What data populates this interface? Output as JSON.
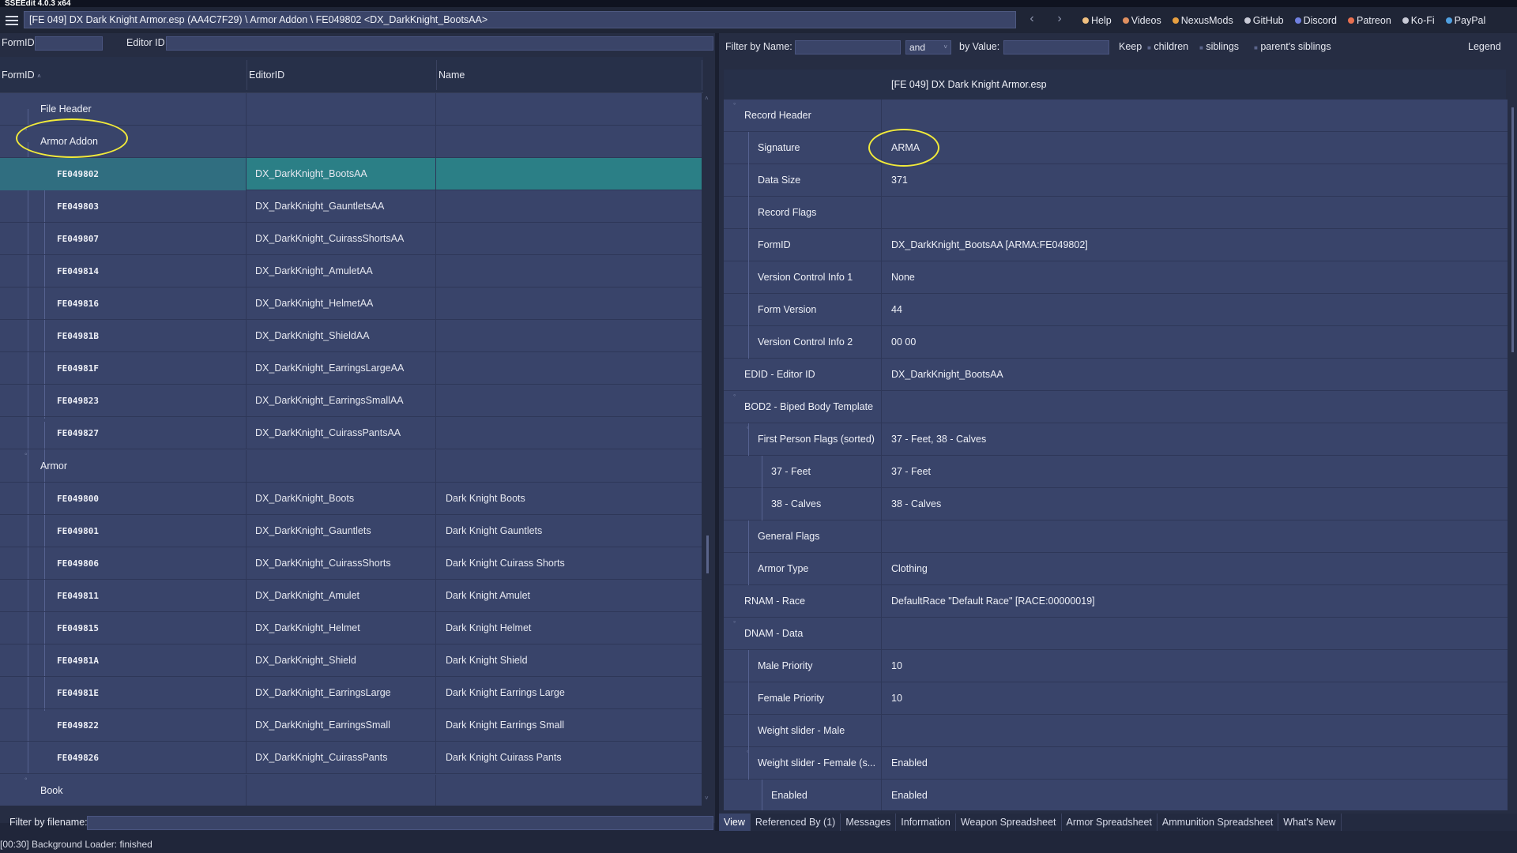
{
  "app": {
    "title": "SSEEdit 4.0.3 x64"
  },
  "topbar": {
    "path": "[FE 049] DX Dark Knight Armor.esp (AA4C7F29) \\ Armor Addon \\ FE049802 <DX_DarkKnight_BootsAA>",
    "links": [
      {
        "label": "Help",
        "color": "#f0c080"
      },
      {
        "label": "Videos",
        "color": "#e09060"
      },
      {
        "label": "NexusMods",
        "color": "#e8a040"
      },
      {
        "label": "GitHub",
        "color": "#c8cad6"
      },
      {
        "label": "Discord",
        "color": "#7080e0"
      },
      {
        "label": "Patreon",
        "color": "#e87050"
      },
      {
        "label": "Ko-Fi",
        "color": "#c8cad6"
      },
      {
        "label": "PayPal",
        "color": "#50a0e0"
      }
    ]
  },
  "left": {
    "formid_label": "FormID",
    "editorid_label": "Editor ID",
    "columns": {
      "formid": "FormID",
      "editorid": "EditorID",
      "name": "Name"
    },
    "groups": {
      "file_header": "File Header",
      "armor_addon": "Armor Addon",
      "armor": "Armor",
      "book": "Book"
    },
    "armor_addon_rows": [
      {
        "formid": "FE049802",
        "editorid": "DX_DarkKnight_BootsAA",
        "name": ""
      },
      {
        "formid": "FE049803",
        "editorid": "DX_DarkKnight_GauntletsAA",
        "name": ""
      },
      {
        "formid": "FE049807",
        "editorid": "DX_DarkKnight_CuirassShortsAA",
        "name": ""
      },
      {
        "formid": "FE049814",
        "editorid": "DX_DarkKnight_AmuletAA",
        "name": ""
      },
      {
        "formid": "FE049816",
        "editorid": "DX_DarkKnight_HelmetAA",
        "name": ""
      },
      {
        "formid": "FE04981B",
        "editorid": "DX_DarkKnight_ShieldAA",
        "name": ""
      },
      {
        "formid": "FE04981F",
        "editorid": "DX_DarkKnight_EarringsLargeAA",
        "name": ""
      },
      {
        "formid": "FE049823",
        "editorid": "DX_DarkKnight_EarringsSmallAA",
        "name": ""
      },
      {
        "formid": "FE049827",
        "editorid": "DX_DarkKnight_CuirassPantsAA",
        "name": ""
      }
    ],
    "armor_rows": [
      {
        "formid": "FE049800",
        "editorid": "DX_DarkKnight_Boots",
        "name": "Dark Knight Boots"
      },
      {
        "formid": "FE049801",
        "editorid": "DX_DarkKnight_Gauntlets",
        "name": "Dark Knight Gauntlets"
      },
      {
        "formid": "FE049806",
        "editorid": "DX_DarkKnight_CuirassShorts",
        "name": "Dark Knight Cuirass Shorts"
      },
      {
        "formid": "FE049811",
        "editorid": "DX_DarkKnight_Amulet",
        "name": "Dark Knight Amulet"
      },
      {
        "formid": "FE049815",
        "editorid": "DX_DarkKnight_Helmet",
        "name": "Dark Knight Helmet"
      },
      {
        "formid": "FE04981A",
        "editorid": "DX_DarkKnight_Shield",
        "name": "Dark Knight Shield"
      },
      {
        "formid": "FE04981E",
        "editorid": "DX_DarkKnight_EarringsLarge",
        "name": "Dark Knight Earrings Large"
      },
      {
        "formid": "FE049822",
        "editorid": "DX_DarkKnight_EarringsSmall",
        "name": "Dark Knight Earrings Small"
      },
      {
        "formid": "FE049826",
        "editorid": "DX_DarkKnight_CuirassPants",
        "name": "Dark Knight Cuirass Pants"
      }
    ],
    "filter_by_filename_label": "Filter by filename:",
    "status": "[00:30] Background Loader: finished"
  },
  "right": {
    "filter_by_name_label": "Filter by Name:",
    "and_label": "and",
    "by_value_label": "by Value:",
    "keep_label": "Keep",
    "children_label": "children",
    "siblings_label": "siblings",
    "parents_siblings_label": "parent's siblings",
    "legend_label": "Legend",
    "header_file": "[FE 049] DX Dark Knight Armor.esp",
    "record_rows": [
      {
        "key": "Record Header",
        "value": "",
        "level": 0,
        "expander": true
      },
      {
        "key": "Signature",
        "value": "ARMA",
        "level": 1,
        "expander": false
      },
      {
        "key": "Data Size",
        "value": "371",
        "level": 1,
        "expander": false
      },
      {
        "key": "Record Flags",
        "value": "",
        "level": 1,
        "expander": false
      },
      {
        "key": "FormID",
        "value": "DX_DarkKnight_BootsAA [ARMA:FE049802]",
        "level": 1,
        "expander": false
      },
      {
        "key": "Version Control Info 1",
        "value": "None",
        "level": 1,
        "expander": false
      },
      {
        "key": "Form Version",
        "value": "44",
        "level": 1,
        "expander": false
      },
      {
        "key": "Version Control Info 2",
        "value": "00 00",
        "level": 1,
        "expander": false
      },
      {
        "key": "EDID - Editor ID",
        "value": "DX_DarkKnight_BootsAA",
        "level": 0,
        "expander": false
      },
      {
        "key": "BOD2 - Biped Body Template",
        "value": "",
        "level": 0,
        "expander": true
      },
      {
        "key": "First Person Flags (sorted)",
        "value": "37 - Feet, 38 - Calves",
        "level": 1,
        "expander": true
      },
      {
        "key": "37 - Feet",
        "value": "37 - Feet",
        "level": 2,
        "expander": false
      },
      {
        "key": "38 - Calves",
        "value": "38 - Calves",
        "level": 2,
        "expander": false
      },
      {
        "key": "General Flags",
        "value": "",
        "level": 1,
        "expander": false
      },
      {
        "key": "Armor Type",
        "value": "Clothing",
        "level": 1,
        "expander": false
      },
      {
        "key": "RNAM - Race",
        "value": "DefaultRace \"Default Race\" [RACE:00000019]",
        "level": 0,
        "expander": false
      },
      {
        "key": "DNAM - Data",
        "value": "",
        "level": 0,
        "expander": true
      },
      {
        "key": "Male Priority",
        "value": "10",
        "level": 1,
        "expander": false
      },
      {
        "key": "Female Priority",
        "value": "10",
        "level": 1,
        "expander": false
      },
      {
        "key": "Weight slider - Male",
        "value": "",
        "level": 1,
        "expander": false
      },
      {
        "key": "Weight slider - Female (s...",
        "value": "Enabled",
        "level": 1,
        "expander": true
      },
      {
        "key": "Enabled",
        "value": "Enabled",
        "level": 2,
        "expander": false
      }
    ],
    "tabs": [
      "View",
      "Referenced By (1)",
      "Messages",
      "Information",
      "Weapon Spreadsheet",
      "Armor Spreadsheet",
      "Ammunition Spreadsheet",
      "What's New"
    ],
    "active_tab": "View"
  },
  "highlight_color": "#f1ea3a",
  "selection_color": "#2b7f86"
}
